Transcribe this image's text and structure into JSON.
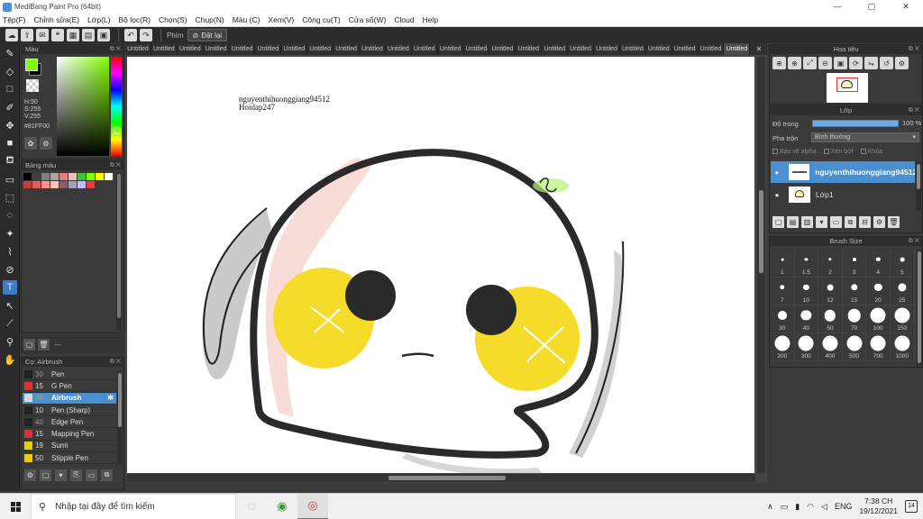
{
  "window": {
    "title": "MediBang Paint Pro (64bit)",
    "controls": {
      "minimize": "—",
      "maximize": "▢",
      "close": "✕"
    }
  },
  "menu": [
    "Tệp(F)",
    "Chỉnh sửa(E)",
    "Lớp(L)",
    "Bộ lọc(R)",
    "Chọn(S)",
    "Chụp(N)",
    "Màu (C)",
    "Xem(V)",
    "Công cụ(T)",
    "Cửa sổ(W)",
    "Cloud",
    "Help"
  ],
  "toolbar": {
    "key_label": "Phím",
    "reset_label": "Đặt lại"
  },
  "color_panel": {
    "title": "Màu",
    "fg_color": "#81FF00",
    "hsv": {
      "h": "H:90",
      "s": "S:255",
      "v": "V:255"
    },
    "hex": "#81FF00"
  },
  "palette_panel": {
    "title": "Bảng màu",
    "swatches": [
      "#000000",
      "#404040",
      "#808080",
      "#b0a0a0",
      "#e08080",
      "#f0c0c0",
      "#40c040",
      "#80ff00",
      "#ffff00",
      "#ffffff",
      "#c04040",
      "#e06060",
      "#ff9090",
      "#ffc0c0",
      "#806060",
      "#a0a0c0",
      "#c0c0ff",
      "#e04040"
    ],
    "footer_text": "---"
  },
  "brush_panel": {
    "title": "Cọ: Airbrush",
    "brushes": [
      {
        "size": "30",
        "name": "Pen",
        "color": "#222222",
        "faded": true
      },
      {
        "size": "15",
        "name": "G Pen",
        "color": "#e03030",
        "faded": false
      },
      {
        "size": "30",
        "name": "Airbrush",
        "color": "#d9d9d9",
        "faded": true,
        "active": true
      },
      {
        "size": "10",
        "name": "Pen (Sharp)",
        "color": "#222222",
        "faded": false
      },
      {
        "size": "40",
        "name": "Edge Pen",
        "color": "#222222",
        "faded": true
      },
      {
        "size": "15",
        "name": "Mapping Pen",
        "color": "#e03030",
        "faded": false
      },
      {
        "size": "19",
        "name": "Sumi",
        "color": "#e8d000",
        "faded": false
      },
      {
        "size": "50",
        "name": "Stipple Pen",
        "color": "#e8d000",
        "faded": false
      }
    ]
  },
  "tabs": {
    "label": "Untitled",
    "count": 24,
    "active_index": 23,
    "close": "✕"
  },
  "canvas": {
    "signature_line1": "nguyenthihuonggiang94512",
    "signature_line2": "Hoidap247"
  },
  "navigator": {
    "title": "Hoa tiêu"
  },
  "layer_panel": {
    "title": "Lớp",
    "opacity_label": "Độ trong",
    "opacity_value": "100 %",
    "opacity": 1.0,
    "blend_label": "Pha trộn",
    "blend_value": "Bình thường",
    "protect_alpha": "Bảo vệ alpha",
    "clip": "Xén bớt",
    "lock": "Khóa",
    "layers": [
      {
        "name": "nguyenthihuonggiang94512",
        "active": true
      },
      {
        "name": "Lớp1",
        "active": false
      }
    ]
  },
  "brush_size_panel": {
    "title": "Brush Size",
    "sizes": [
      "1",
      "1.5",
      "2",
      "3",
      "4",
      "5",
      "7",
      "10",
      "12",
      "15",
      "20",
      "25",
      "30",
      "40",
      "50",
      "70",
      "100",
      "150",
      "200",
      "300",
      "400",
      "500",
      "700",
      "1000"
    ]
  },
  "taskbar": {
    "search_placeholder": "Nhập tại đây để tìm kiếm",
    "language": "ENG",
    "time": "7:38 CH",
    "date": "19/12/2021",
    "notifications": "14"
  }
}
